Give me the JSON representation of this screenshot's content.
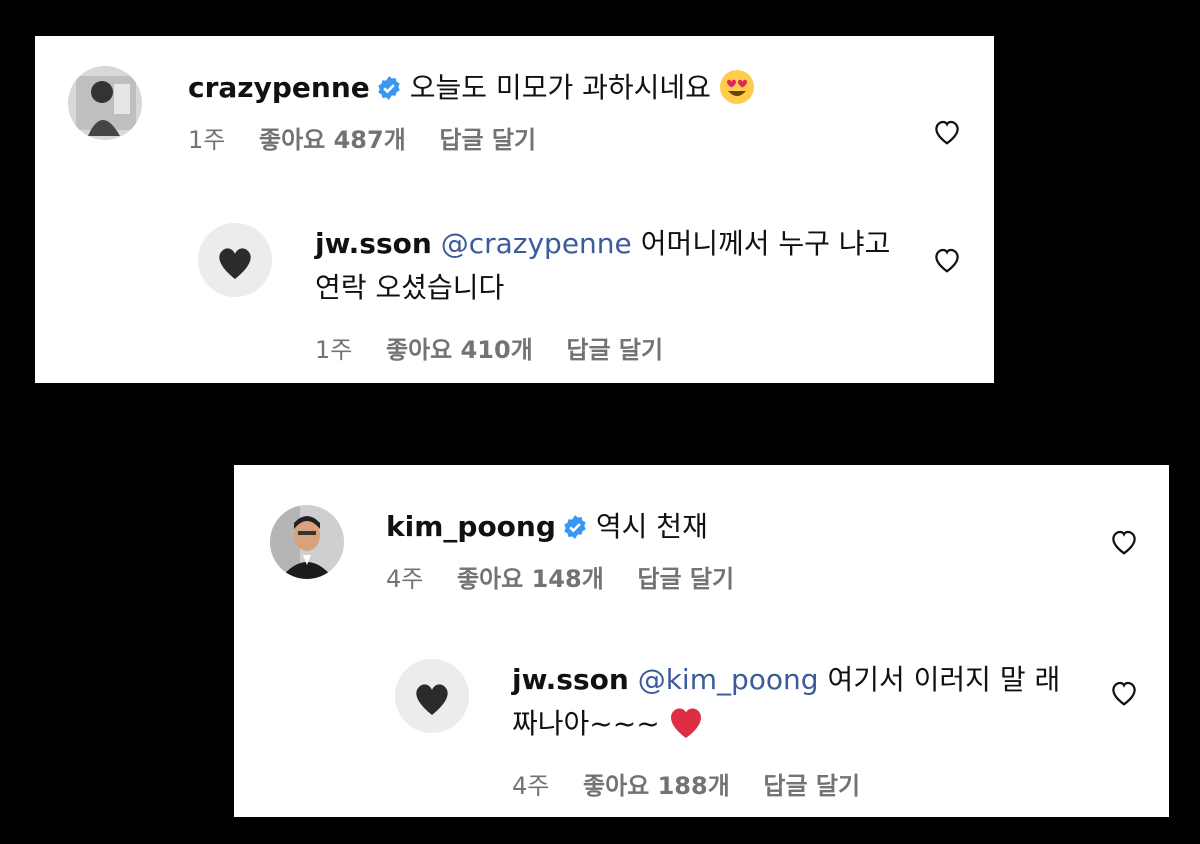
{
  "threads": [
    {
      "comment": {
        "username": "crazypenne",
        "verified": true,
        "text": "오늘도 미모가 과하시네요",
        "emoji": "heart-eyes-emoji",
        "time": "1주",
        "likes": "좋아요 487개",
        "reply_label": "답글 달기"
      },
      "reply": {
        "username": "jw.sson",
        "mention": "@crazypenne",
        "text": "어머니께서 누구 냐고 연락 오셨습니다",
        "time": "1주",
        "likes": "좋아요 410개",
        "reply_label": "답글 달기"
      }
    },
    {
      "comment": {
        "username": "kim_poong",
        "verified": true,
        "text": "역시 천재",
        "time": "4주",
        "likes": "좋아요 148개",
        "reply_label": "답글 달기"
      },
      "reply": {
        "username": "jw.sson",
        "mention": "@kim_poong",
        "text": "여기서 이러지 말 래짜나아~~~",
        "emoji": "red-heart-emoji",
        "time": "4주",
        "likes": "좋아요 188개",
        "reply_label": "답글 달기"
      }
    }
  ],
  "colors": {
    "background": "#000000",
    "panel": "#ffffff",
    "mention": "#3b5b9b",
    "meta": "#737373",
    "verified": "#3897f0"
  }
}
